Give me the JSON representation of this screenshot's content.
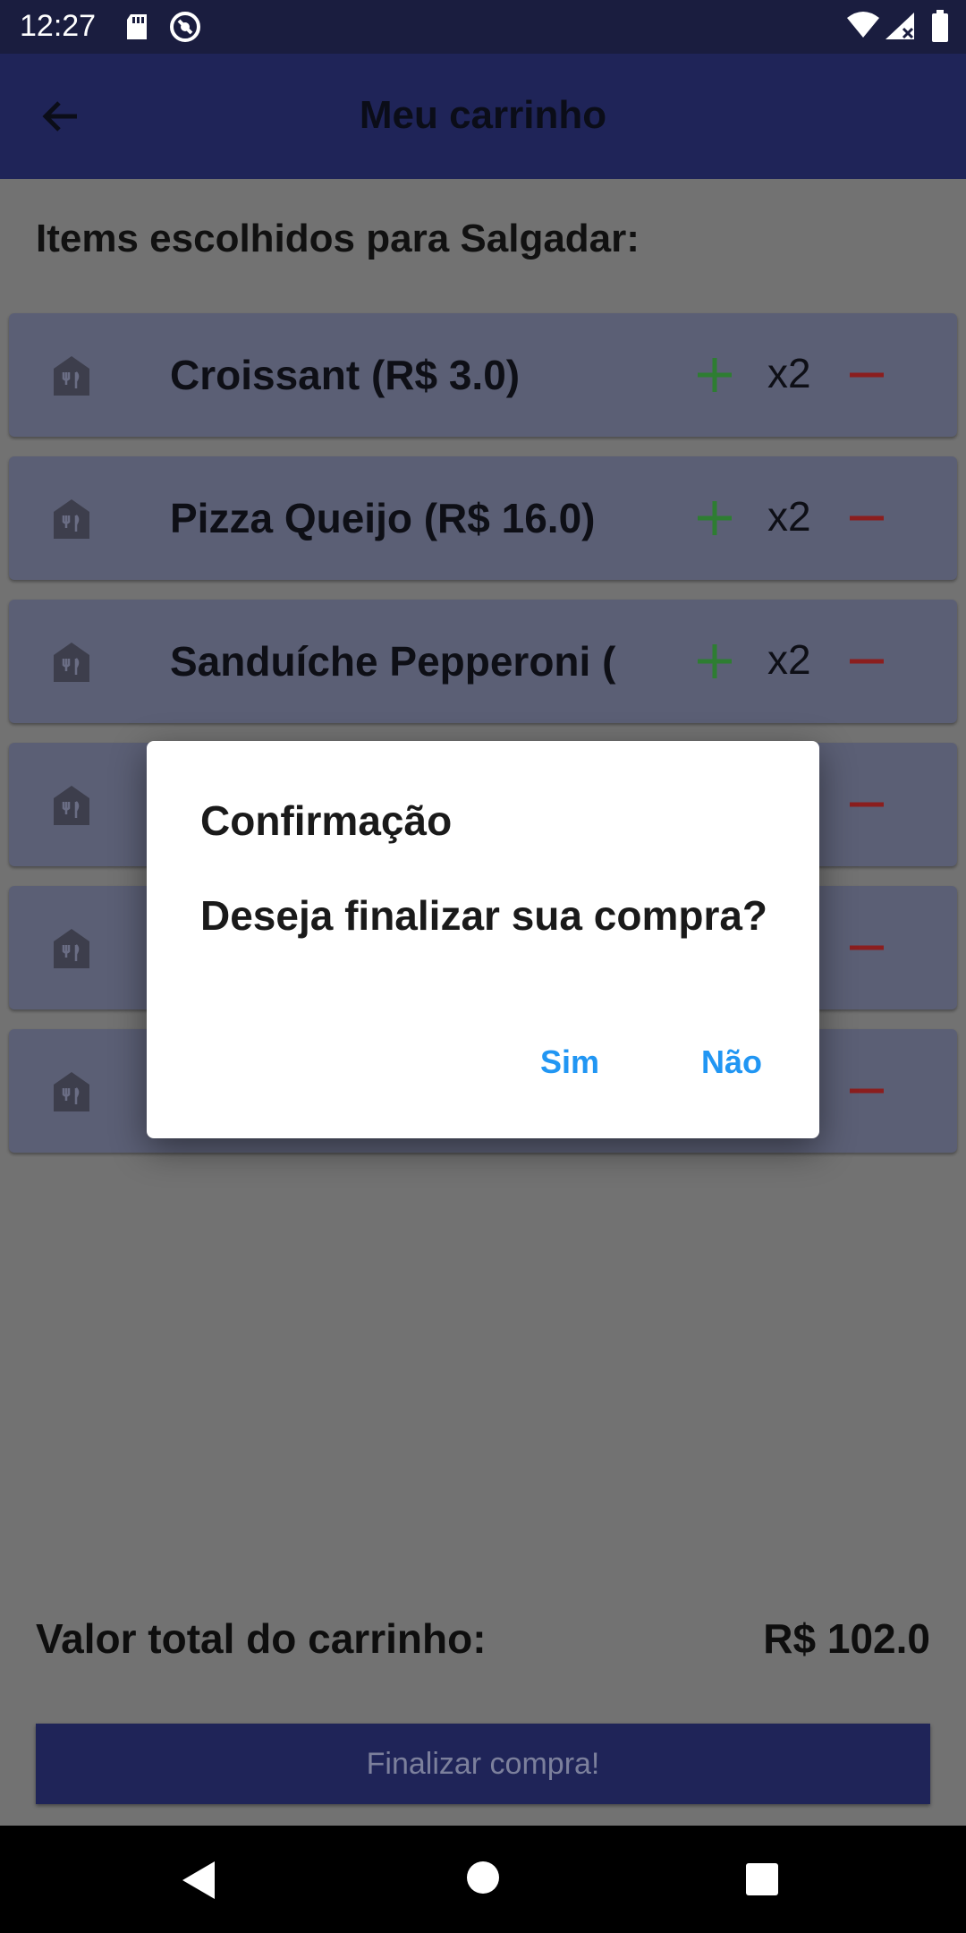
{
  "status_bar": {
    "time": "12:27"
  },
  "app_bar": {
    "title": "Meu carrinho"
  },
  "cart": {
    "heading": "Items escolhidos para Salgadar:",
    "items": [
      {
        "name": "Croissant (R$ 3.0)",
        "quantity": "x2"
      },
      {
        "name": "Pizza Queijo (R$ 16.0)",
        "quantity": "x2"
      },
      {
        "name": "Sanduíche Pepperoni  (",
        "quantity": "x2"
      },
      {
        "name": "",
        "quantity": ""
      },
      {
        "name": "",
        "quantity": ""
      },
      {
        "name": "",
        "quantity": ""
      }
    ],
    "total_label": "Valor total do carrinho:",
    "total_value": "R$ 102.0",
    "finish_button": "Finalizar compra!"
  },
  "dialog": {
    "title": "Confirmação",
    "message": "Deseja finalizar sua compra?",
    "confirm_label": "Sim",
    "cancel_label": "Não"
  },
  "colors": {
    "status_bar": "#1a1d3f",
    "app_bar": "#1f2458",
    "plus": "#2e7d32",
    "minus": "#8b1e1e",
    "dialog_button": "#2196f3"
  }
}
